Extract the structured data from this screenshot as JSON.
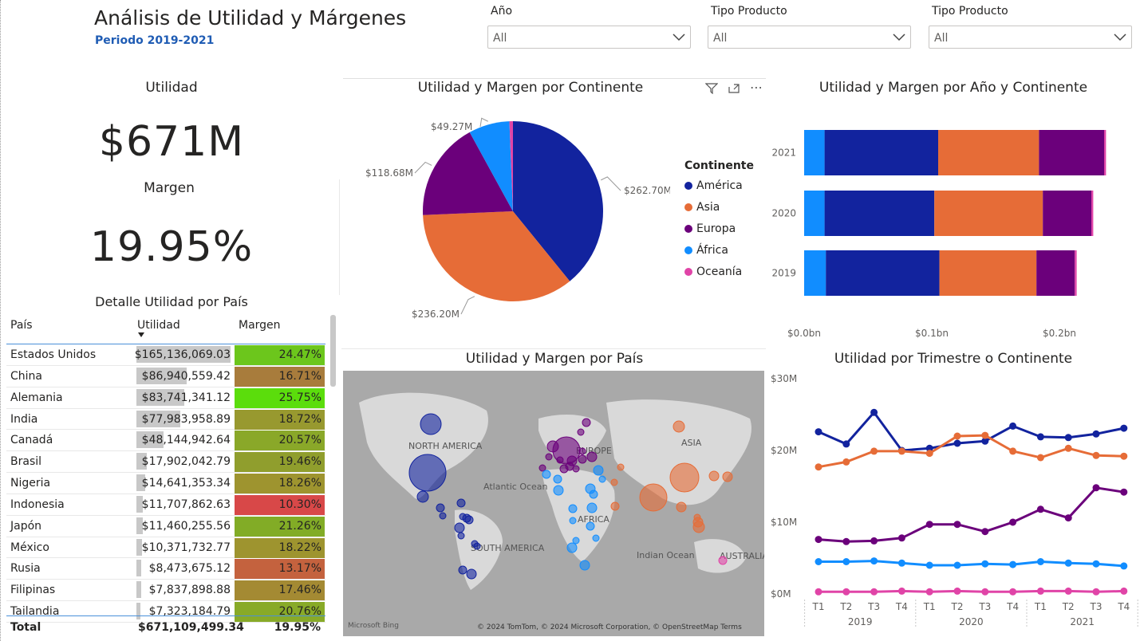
{
  "header": {
    "title": "Análisis de Utilidad y Márgenes",
    "subtitle": "Periodo 2019-2021"
  },
  "slicers": [
    {
      "label": "Año",
      "value": "All"
    },
    {
      "label": "Tipo Producto",
      "value": "All"
    },
    {
      "label": "Tipo Producto",
      "value": "All"
    }
  ],
  "cards": {
    "utilidad_label": "Utilidad",
    "utilidad_value": "$671M",
    "margen_label": "Margen",
    "margen_value": "19.95%"
  },
  "table": {
    "title": "Detalle Utilidad por País",
    "headers": [
      "País",
      "Utilidad",
      "Margen"
    ],
    "rows": [
      {
        "pais": "Estados Unidos",
        "utilidad": "$165,136,069.03",
        "margen": "24.47%",
        "frac": 1.0,
        "color": "#6cc61c"
      },
      {
        "pais": "China",
        "utilidad": "$86,940,559.42",
        "margen": "16.71%",
        "frac": 0.53,
        "color": "#a87c3c"
      },
      {
        "pais": "Alemania",
        "utilidad": "$83,741,341.12",
        "margen": "25.75%",
        "frac": 0.51,
        "color": "#5bdd0c"
      },
      {
        "pais": "India",
        "utilidad": "$77,983,958.89",
        "margen": "18.72%",
        "frac": 0.47,
        "color": "#98992f"
      },
      {
        "pais": "Canadá",
        "utilidad": "$48,144,942.64",
        "margen": "20.57%",
        "frac": 0.29,
        "color": "#8aa829"
      },
      {
        "pais": "Brasil",
        "utilidad": "$17,902,042.79",
        "margen": "19.46%",
        "frac": 0.11,
        "color": "#909e2d"
      },
      {
        "pais": "Nigeria",
        "utilidad": "$14,641,353.34",
        "margen": "18.26%",
        "frac": 0.09,
        "color": "#9e942f"
      },
      {
        "pais": "Indonesia",
        "utilidad": "$11,707,862.63",
        "margen": "10.30%",
        "frac": 0.07,
        "color": "#d84848"
      },
      {
        "pais": "Japón",
        "utilidad": "$11,460,255.56",
        "margen": "21.26%",
        "frac": 0.07,
        "color": "#82ac26"
      },
      {
        "pais": "México",
        "utilidad": "$10,371,732.77",
        "margen": "18.22%",
        "frac": 0.06,
        "color": "#9e942f"
      },
      {
        "pais": "Rusia",
        "utilidad": "$8,473,675.12",
        "margen": "13.17%",
        "frac": 0.05,
        "color": "#c4623e"
      },
      {
        "pais": "Filipinas",
        "utilidad": "$7,837,898.88",
        "margen": "17.46%",
        "frac": 0.05,
        "color": "#a48a33"
      },
      {
        "pais": "Tailandia",
        "utilidad": "$7,323,184.79",
        "margen": "20.76%",
        "frac": 0.04,
        "color": "#88aa28"
      }
    ],
    "total": {
      "label": "Total",
      "utilidad": "$671,109,499.34",
      "margen": "19.95%"
    }
  },
  "colors": {
    "america": "#12239e",
    "asia": "#e66c37",
    "europa": "#6b007b",
    "africa": "#118dff",
    "oceania": "#e044a7"
  },
  "chart_data": [
    {
      "type": "pie",
      "title": "Utilidad y Margen por Continente",
      "legend_title": "Continente",
      "categories": [
        "América",
        "Asia",
        "Europa",
        "África",
        "Oceanía"
      ],
      "values": [
        262.7,
        236.2,
        118.68,
        49.27,
        4.26
      ],
      "labels": [
        "$262.70M",
        "$236.20M",
        "$118.68M",
        "$49.27M",
        ""
      ],
      "legend_position": "right"
    },
    {
      "type": "bar",
      "title": "Utilidad y Margen por Año y Continente",
      "categories": [
        "2021",
        "2020",
        "2019"
      ],
      "series": [
        {
          "name": "África",
          "values": [
            0.016,
            0.016,
            0.017
          ]
        },
        {
          "name": "América",
          "values": [
            0.089,
            0.086,
            0.089
          ]
        },
        {
          "name": "Asia",
          "values": [
            0.079,
            0.085,
            0.076
          ]
        },
        {
          "name": "Europa",
          "values": [
            0.051,
            0.038,
            0.03
          ]
        },
        {
          "name": "Oceanía",
          "values": [
            0.0015,
            0.0015,
            0.0015
          ]
        }
      ],
      "x_ticks": [
        "$0.0bn",
        "$0.1bn",
        "$0.2bn"
      ],
      "xlim": [
        0,
        0.2
      ]
    },
    {
      "type": "scatter",
      "title": "Utilidad y Margen por País",
      "map": true,
      "labels": [
        "NORTH AMERICA",
        "EUROPE",
        "ASIA",
        "Atlantic Ocean",
        "AFRICA",
        "SOUTH AMERICA",
        "Indian Ocean",
        "AUSTRALIA"
      ],
      "attribution": "© 2024 TomTom, © 2024 Microsoft Corporation, © OpenStreetMap  Terms",
      "brand": "Microsoft Bing"
    },
    {
      "type": "line",
      "title": "Utilidad por Trimestre o Continente",
      "x": [
        "T1",
        "T2",
        "T3",
        "T4",
        "T1",
        "T2",
        "T3",
        "T4",
        "T1",
        "T2",
        "T3",
        "T4"
      ],
      "x_groups": [
        "2019",
        "2020",
        "2021"
      ],
      "y_ticks": [
        "$30M",
        "$20M",
        "$10M",
        "$0M"
      ],
      "ylim": [
        0,
        30
      ],
      "series": [
        {
          "name": "América",
          "values": [
            22.6,
            20.9,
            25.3,
            20.0,
            20.3,
            21.0,
            21.3,
            23.4,
            21.9,
            21.8,
            22.3,
            23.1
          ]
        },
        {
          "name": "Asia",
          "values": [
            17.7,
            18.4,
            19.9,
            19.9,
            19.6,
            22.0,
            22.1,
            19.9,
            19.0,
            20.3,
            19.3,
            19.2
          ]
        },
        {
          "name": "Europa",
          "values": [
            7.6,
            7.3,
            7.4,
            7.8,
            9.7,
            9.7,
            8.7,
            10.0,
            11.8,
            10.6,
            14.8,
            14.2
          ]
        },
        {
          "name": "África",
          "values": [
            4.5,
            4.5,
            4.6,
            4.3,
            4.0,
            4.0,
            4.2,
            4.1,
            4.5,
            4.3,
            4.2,
            3.9
          ]
        },
        {
          "name": "Oceanía",
          "values": [
            0.3,
            0.3,
            0.3,
            0.4,
            0.3,
            0.4,
            0.3,
            0.3,
            0.4,
            0.4,
            0.3,
            0.4
          ]
        }
      ]
    }
  ]
}
